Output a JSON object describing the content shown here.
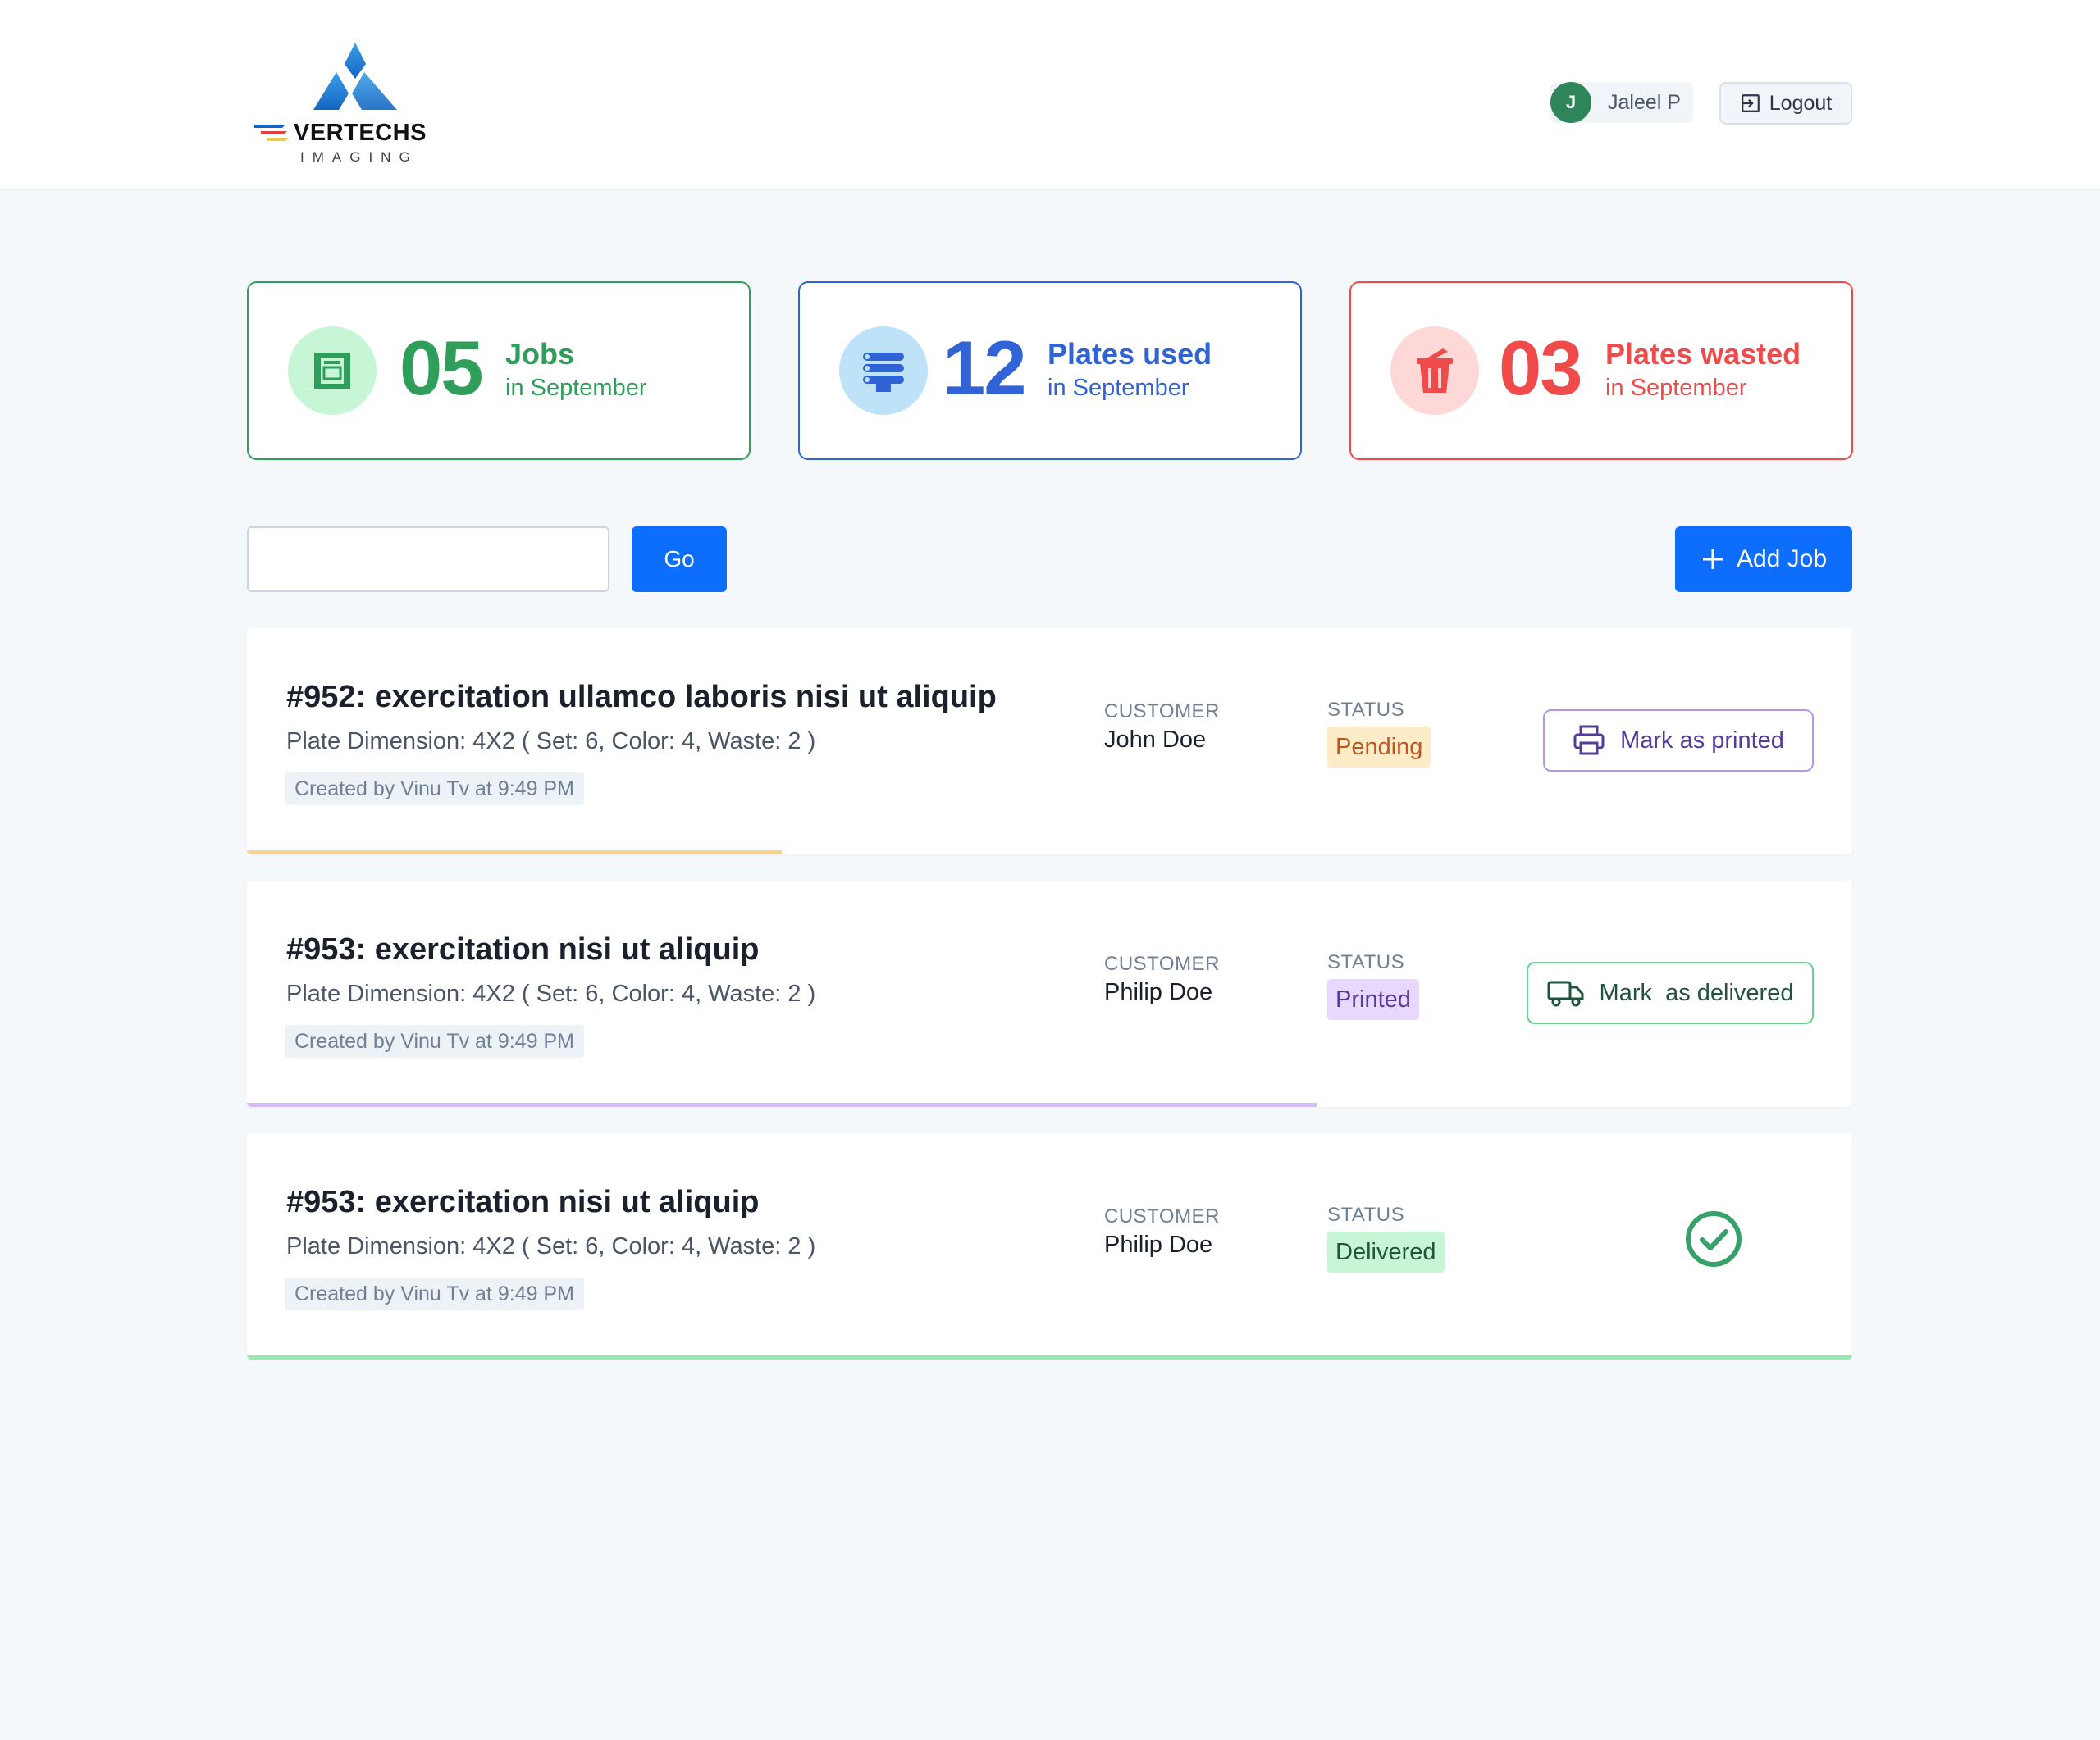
{
  "header": {
    "logo_word": "VERTECHS",
    "logo_sub": "IMAGING",
    "user_initial": "J",
    "user_name": "Jaleel P",
    "logout_label": "Logout"
  },
  "stats": [
    {
      "number": "05",
      "label": "Jobs",
      "sub": "in September",
      "color": "#2f9e5a",
      "icon": "printer-machine-icon"
    },
    {
      "number": "12",
      "label": "Plates used",
      "sub": "in September",
      "color": "#2f63d6",
      "icon": "plates-stack-icon"
    },
    {
      "number": "03",
      "label": "Plates wasted",
      "sub": "in September",
      "color": "#f04b4b",
      "icon": "trash-bin-icon"
    }
  ],
  "toolbar": {
    "search_value": "",
    "search_placeholder": "",
    "go_label": "Go",
    "add_job_label": "Add Job"
  },
  "meta_labels": {
    "customer": "CUSTOMER",
    "status": "STATUS"
  },
  "jobs": [
    {
      "title": "#952: exercitation ullamco laboris nisi ut aliquip",
      "dimension": "Plate Dimension: 4X2 ( Set: 6, Color: 4, Waste: 2 )",
      "created": "Created by Vinu Tv at 9:49 PM",
      "customer": "John Doe",
      "status": "Pending",
      "status_bg": "#feebc8",
      "status_color": "#c05621",
      "progress": 0.333,
      "progress_color": "#f6d58a",
      "action_label": "Mark as printed",
      "action_icon": "printer-icon",
      "action_color": "#553c9a",
      "action_border": "#b794f4"
    },
    {
      "title": "#953: exercitation nisi ut aliquip",
      "dimension": "Plate Dimension: 4X2 ( Set: 6, Color: 4, Waste: 2 )",
      "created": "Created by Vinu Tv at 9:49 PM",
      "customer": "Philip Doe",
      "status": "Printed",
      "status_bg": "#e9d8fd",
      "status_color": "#553c9a",
      "progress": 0.667,
      "progress_color": "#d6bcfa",
      "action_label": "Mark  as delivered",
      "action_icon": "truck-icon",
      "action_color": "#22543d",
      "action_border": "#68d391"
    },
    {
      "title": "#953: exercitation nisi ut aliquip",
      "dimension": "Plate Dimension: 4X2 ( Set: 6, Color: 4, Waste: 2 )",
      "created": "Created by Vinu Tv at 9:49 PM",
      "customer": "Philip Doe",
      "status": "Delivered",
      "status_bg": "#c6f6d5",
      "status_color": "#22543d",
      "progress": 1.0,
      "progress_color": "#9ae6b4",
      "action_icon": "check-circle-icon",
      "action_color": "#38a169"
    }
  ]
}
